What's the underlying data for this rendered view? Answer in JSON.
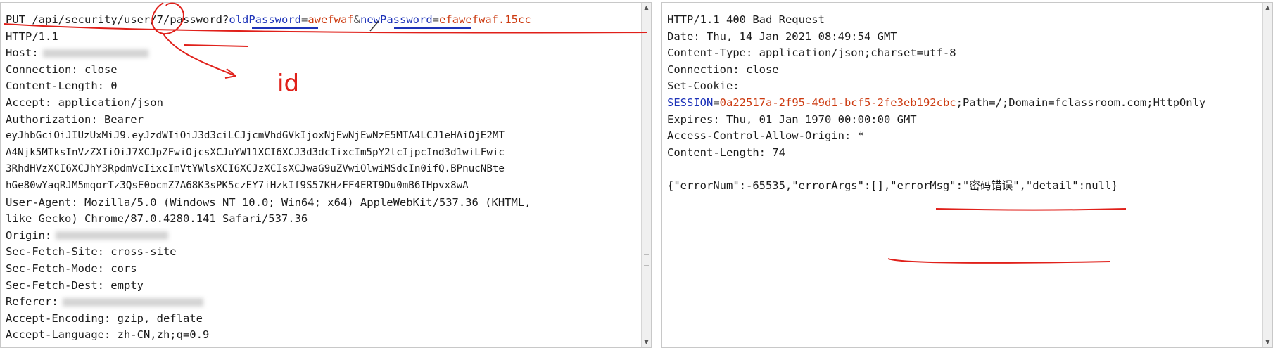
{
  "request": {
    "request_line": {
      "method": "PUT",
      "path_start": "/api/security/user/",
      "user_id": "7",
      "path_end": "/password?",
      "param1_name": "oldPassword",
      "eq": "=",
      "param1_value": "awefwaf",
      "amp": "&",
      "param2_name": "newPassword",
      "param2_value": "efawefwaf.15cc"
    },
    "protocol": "HTTP/1.1",
    "host_label": "Host:",
    "connection": "Connection: close",
    "content_length": "Content-Length: 0",
    "accept": "Accept: application/json",
    "authorization": "Authorization: Bearer",
    "token_lines": [
      "eyJhbGciOiJIUzUxMiJ9.eyJzdWIiOiJ3d3ciLCJjcmVhdGVkIjoxNjEwNjEwNzE5MTA4LCJ1eHAiOjE2MT",
      "A4Njk5MTksInVzZXIiOiJ7XCJpZFwiOjcsXCJuYW11XCI6XCJ3d3dcIixcIm5pY2tcIjpcInd3d1wiLFwic",
      "3RhdHVzXCI6XCJhY3RpdmVcIixcImVtYWlsXCI6XCJzXCIsXCJwaG9uZVwiOlwiMSdcIn0ifQ.BPnucNBte",
      "hGe80wYaqRJM5mqorTz3QsE0ocmZ7A68K3sPK5czEY7iHzkIf9S57KHzFF4ERT9Du0mB6IHpvx8wA"
    ],
    "user_agent_1": "User-Agent: Mozilla/5.0 (Windows NT 10.0; Win64; x64) AppleWebKit/537.36 (KHTML,",
    "user_agent_2": "like Gecko) Chrome/87.0.4280.141 Safari/537.36",
    "origin_label": "Origin:",
    "sec_fetch_site": "Sec-Fetch-Site: cross-site",
    "sec_fetch_mode": "Sec-Fetch-Mode: cors",
    "sec_fetch_dest": "Sec-Fetch-Dest: empty",
    "referer_label": "Referer:",
    "accept_encoding": "Accept-Encoding: gzip, deflate",
    "accept_language": "Accept-Language: zh-CN,zh;q=0.9"
  },
  "response": {
    "status_line": "HTTP/1.1 400 Bad Request",
    "date": "Date: Thu, 14 Jan 2021 08:49:54 GMT",
    "content_type": "Content-Type: application/json;charset=utf-8",
    "connection": "Connection: close",
    "set_cookie": "Set-Cookie:",
    "session_key": "SESSION",
    "session_eq": "=",
    "session_value": "0a22517a-2f95-49d1-bcf5-2fe3eb192cbc",
    "session_rest": ";Path=/;Domain=fclassroom.com;HttpOnly",
    "expires": "Expires: Thu, 01 Jan 1970 00:00:00 GMT",
    "acao": "Access-Control-Allow-Origin: *",
    "content_length": "Content-Length: 74",
    "body": "{\"errorNum\":-65535,\"errorArgs\":[],\"errorMsg\":\"密码错误\",\"detail\":null}"
  },
  "annotation": {
    "handwritten_text": "id"
  },
  "colors": {
    "param_name": "#1c32b8",
    "param_value": "#cc3a10",
    "annotation_red": "#e0201a"
  }
}
